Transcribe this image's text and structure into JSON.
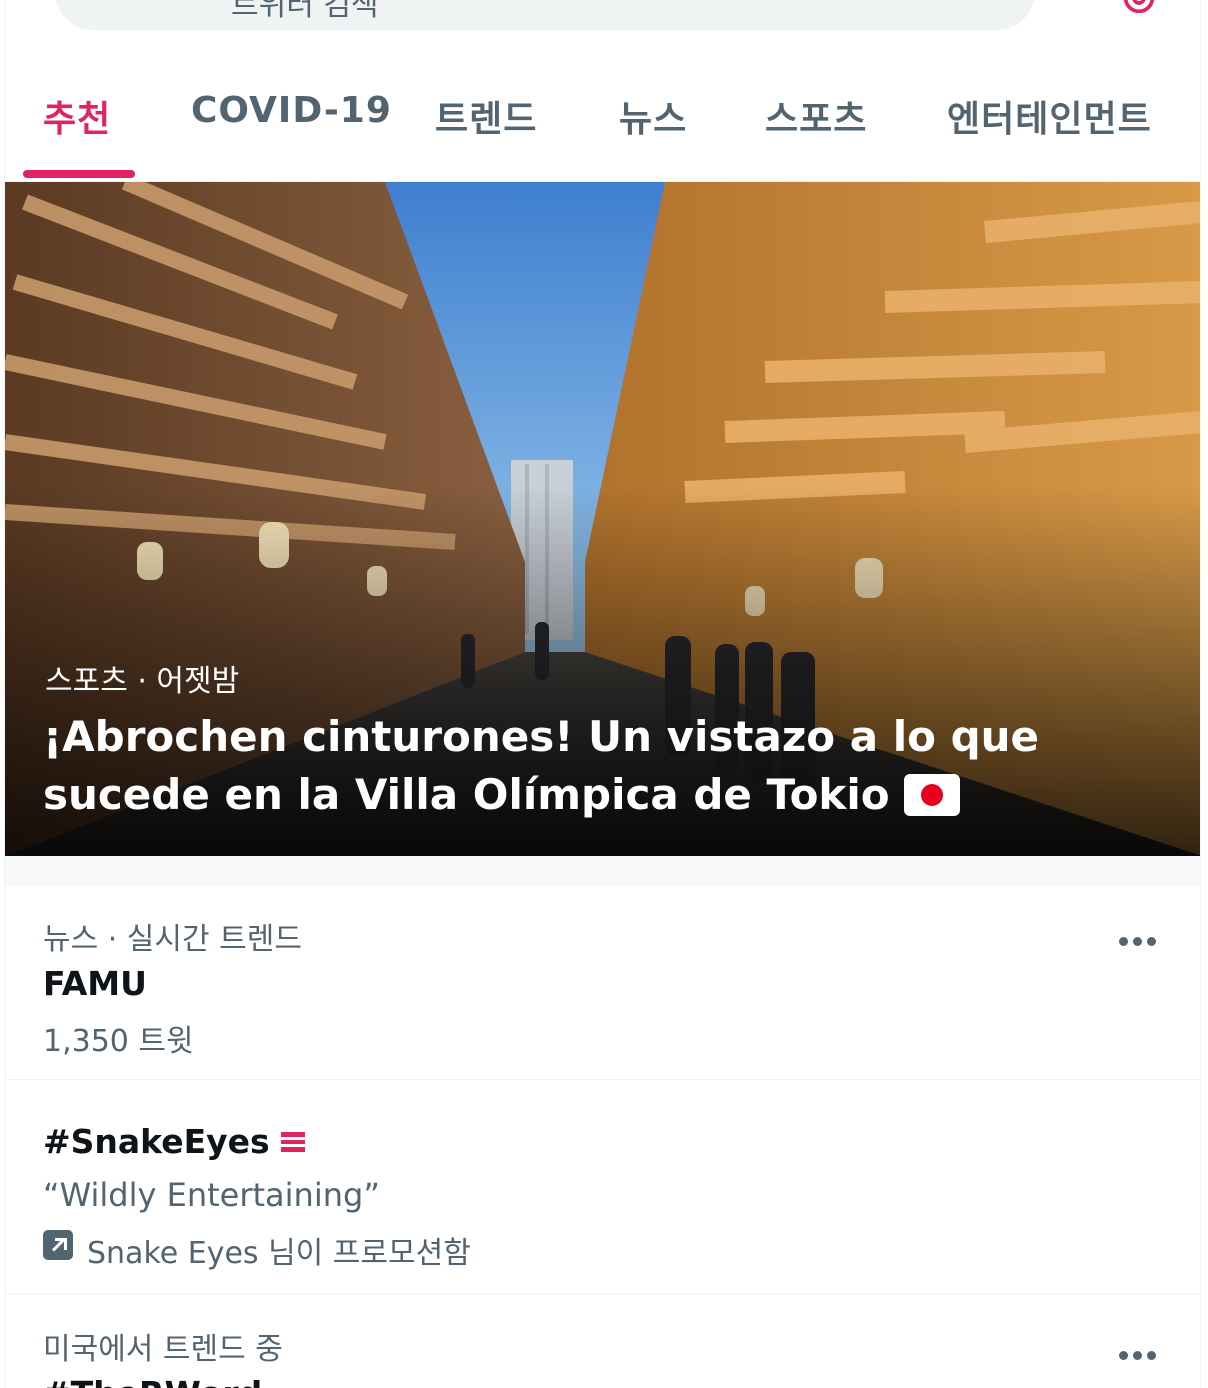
{
  "search": {
    "placeholder": "트위터 검색"
  },
  "icons": {
    "search": "search-icon",
    "settings": "settings-gear-icon",
    "more": "more-horizontal-icon",
    "promoted": "promoted-arrow-icon",
    "flag": "japan-flag-emoji",
    "snake": "snake-eyes-emoji"
  },
  "colors": {
    "accent": "#e0245e",
    "secondary_text": "#536471",
    "primary_text": "#0f1419",
    "divider": "#eff3f4"
  },
  "tabs": [
    {
      "label": "추천",
      "active": true
    },
    {
      "label": "COVID-19",
      "active": false
    },
    {
      "label": "트렌드",
      "active": false
    },
    {
      "label": "뉴스",
      "active": false
    },
    {
      "label": "스포츠",
      "active": false
    },
    {
      "label": "엔터테인먼트",
      "active": false
    }
  ],
  "hero": {
    "meta": "스포츠 · 어젯밤",
    "headline": "¡Abrochen cinturones! Un vistazo a lo que sucede en la Villa Olímpica de Tokio"
  },
  "trends": [
    {
      "context": "뉴스 · 실시간 트렌드",
      "title": "FAMU",
      "count": "1,350 트윗"
    },
    {
      "title": "#SnakeEyes",
      "description": "“Wildly Entertaining”",
      "promoted_by": "Snake Eyes 님이 프로모션함"
    },
    {
      "context": "미국에서 트렌드 중",
      "title": "#TheRWord"
    }
  ]
}
